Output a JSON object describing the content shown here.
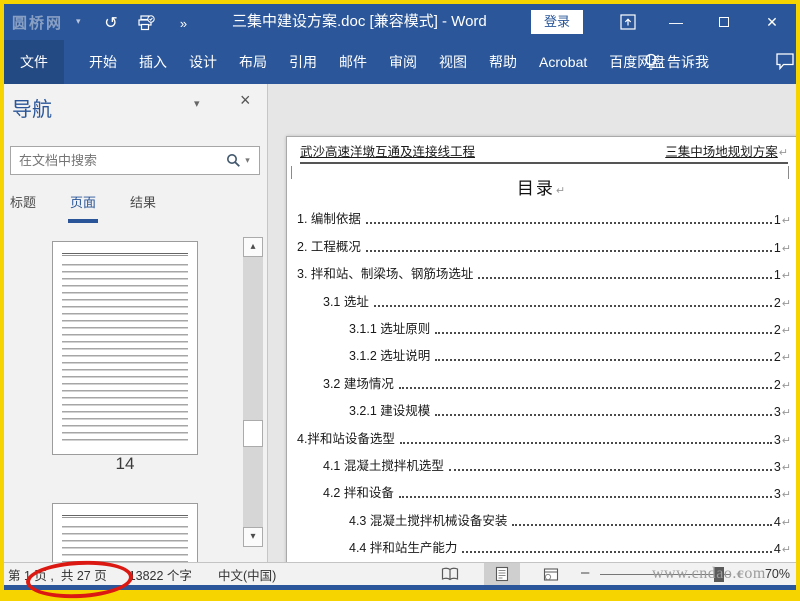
{
  "window": {
    "site_logo": "圆桥网",
    "title": "三集中建设方案.doc [兼容模式] - Word",
    "sign_in_label": "登录"
  },
  "ribbon": {
    "tabs": [
      "文件",
      "开始",
      "插入",
      "设计",
      "布局",
      "引用",
      "邮件",
      "审阅",
      "视图",
      "帮助",
      "Acrobat",
      "百度网盘"
    ],
    "tell_me_label": "告诉我"
  },
  "nav_pane": {
    "title": "导航",
    "search_placeholder": "在文档中搜索",
    "tabs": [
      {
        "label": "标题",
        "active": false
      },
      {
        "label": "页面",
        "active": true
      },
      {
        "label": "结果",
        "active": false
      }
    ],
    "visible_thumbnail_page": "14"
  },
  "document": {
    "header_left": "武沙高速洋墩互通及连接线工程",
    "header_right": "三集中场地规划方案",
    "title": "目录",
    "toc": [
      {
        "level": 0,
        "label": "1. 编制依据",
        "page": "1"
      },
      {
        "level": 0,
        "label": "2. 工程概况",
        "page": "1"
      },
      {
        "level": 0,
        "label": "3. 拌和站、制梁场、钢筋场选址",
        "page": "1"
      },
      {
        "level": 1,
        "label": "3.1 选址",
        "page": "2"
      },
      {
        "level": 2,
        "label": "3.1.1 选址原则",
        "page": "2"
      },
      {
        "level": 2,
        "label": "3.1.2 选址说明",
        "page": "2"
      },
      {
        "level": 1,
        "label": "3.2 建场情况",
        "page": "2"
      },
      {
        "level": 2,
        "label": "3.2.1 建设规模",
        "page": "3"
      },
      {
        "level": 0,
        "label": "4.拌和站设备选型",
        "page": "3"
      },
      {
        "level": 1,
        "label": "4.1 混凝土搅拌机选型",
        "page": "3"
      },
      {
        "level": 1,
        "label": "4.2 拌和设备",
        "page": "3"
      },
      {
        "level": 2,
        "label": "4.3 混凝土搅拌机械设备安装",
        "page": "4"
      },
      {
        "level": 2,
        "label": "4.4 拌和站生产能力",
        "page": "4"
      }
    ]
  },
  "status_bar": {
    "page_current": "第 1 页 ,",
    "page_total": "共 27 页",
    "word_count": "13822 个字",
    "language": "中文(中国)",
    "zoom_level": "70%"
  },
  "watermark_url": "www.cndao.com",
  "icons": {
    "pilcrow": "↵",
    "undo": "↺",
    "qat_more": "»",
    "dropdown": "▾",
    "close": "×",
    "scroll_up": "▴",
    "scroll_down": "▾",
    "zoom_out": "–",
    "zoom_in": "+"
  },
  "colors": {
    "accent_blue": "#2b579a",
    "frame_yellow": "#f5d400",
    "annotation_red": "#dc1812"
  }
}
